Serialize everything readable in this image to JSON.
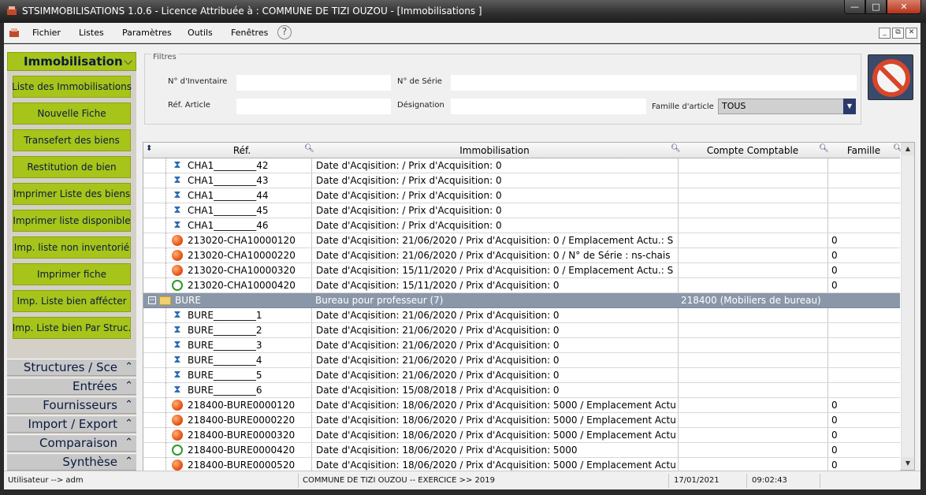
{
  "window": {
    "title": "STSIMMOBILISATIONS 1.0.6   -  Licence Attribuée à :  COMMUNE DE TIZI OUZOU - [Immobilisations ]",
    "minimize": "—",
    "maximize": "□",
    "close": "✕"
  },
  "menu": {
    "items": [
      "Fichier",
      "Listes",
      "Paramètres",
      "Outils",
      "Fenêtres"
    ],
    "help": "?",
    "mdi": [
      "_",
      "⧉",
      "✕"
    ]
  },
  "sidebar": {
    "header": "Immobilisation",
    "buttons": [
      "Liste des Immobilisations",
      "Nouvelle Fiche",
      "Transefert des biens",
      "Restitution de bien",
      "Imprimer Liste des biens",
      "Imprimer liste disponible",
      "Imp. liste non inventorié",
      "Imprimer fiche",
      "Imp. Liste bien affécter",
      "Imp. Liste bien Par Struc."
    ],
    "sections": [
      "Structures / Sce",
      "Entrées",
      "Fournisseurs",
      "Import / Export",
      "Comparaison",
      "Synthèse"
    ]
  },
  "filters": {
    "legend": "Filtres",
    "inventaire_label": "N° d'Inventaire",
    "inventaire_value": "",
    "serie_label": "N° de Série",
    "serie_value": "",
    "ref_article_label": "Réf. Article",
    "ref_article_value": "",
    "designation_label": "Désignation",
    "designation_value": "",
    "famille_label": "Famille d'article",
    "famille_value": "TOUS"
  },
  "grid": {
    "columns": [
      "Réf.",
      "Immobilisation",
      "Compte Comptable",
      "Famille"
    ],
    "rows": [
      {
        "icon": "hourglass",
        "ref": "CHA1_________42",
        "immo": "Date d'Acqisition:   /  Prix d'Acquisition: 0",
        "compte": "",
        "famille": ""
      },
      {
        "icon": "hourglass",
        "ref": "CHA1_________43",
        "immo": "Date d'Acqisition:   /  Prix d'Acquisition: 0",
        "compte": "",
        "famille": ""
      },
      {
        "icon": "hourglass",
        "ref": "CHA1_________44",
        "immo": "Date d'Acqisition:   /  Prix d'Acquisition: 0",
        "compte": "",
        "famille": ""
      },
      {
        "icon": "hourglass",
        "ref": "CHA1_________45",
        "immo": "Date d'Acqisition:   /  Prix d'Acquisition: 0",
        "compte": "",
        "famille": ""
      },
      {
        "icon": "hourglass",
        "ref": "CHA1_________46",
        "immo": "Date d'Acqisition:   /  Prix d'Acquisition: 0",
        "compte": "",
        "famille": ""
      },
      {
        "icon": "orange",
        "ref": "213020-CHA10000120",
        "immo": "Date d'Acqisition: 21/06/2020  /  Prix d'Acquisition: 0 / Emplacement Actu.: S",
        "compte": "",
        "famille": "0"
      },
      {
        "icon": "orange",
        "ref": "213020-CHA10000220",
        "immo": "Date d'Acqisition: 21/06/2020  /  Prix d'Acquisition: 0 / N° de Série :  ns-chais",
        "compte": "",
        "famille": "0"
      },
      {
        "icon": "orange",
        "ref": "213020-CHA10000320",
        "immo": "Date d'Acqisition: 15/11/2020  /  Prix d'Acquisition: 0 / Emplacement Actu.: S",
        "compte": "",
        "famille": "0"
      },
      {
        "icon": "green",
        "ref": "213020-CHA10000420",
        "immo": "Date d'Acqisition: 15/11/2020  /  Prix d'Acquisition: 0",
        "compte": "",
        "famille": "0"
      },
      {
        "group": true,
        "toggle": "−",
        "ref": "BURE",
        "immo": "Bureau pour professeur  (7)",
        "compte": "218400  (Mobiliers de bureau)",
        "famille": ""
      },
      {
        "icon": "hourglass",
        "ref": "BURE_________1",
        "immo": "Date d'Acqisition: 21/06/2020  /  Prix d'Acquisition: 0",
        "compte": "",
        "famille": ""
      },
      {
        "icon": "hourglass",
        "ref": "BURE_________2",
        "immo": "Date d'Acqisition: 21/06/2020  /  Prix d'Acquisition: 0",
        "compte": "",
        "famille": ""
      },
      {
        "icon": "hourglass",
        "ref": "BURE_________3",
        "immo": "Date d'Acqisition: 21/06/2020  /  Prix d'Acquisition: 0",
        "compte": "",
        "famille": ""
      },
      {
        "icon": "hourglass",
        "ref": "BURE_________4",
        "immo": "Date d'Acqisition: 21/06/2020  /  Prix d'Acquisition: 0",
        "compte": "",
        "famille": ""
      },
      {
        "icon": "hourglass",
        "ref": "BURE_________5",
        "immo": "Date d'Acqisition: 21/06/2020  /  Prix d'Acquisition: 0",
        "compte": "",
        "famille": ""
      },
      {
        "icon": "hourglass",
        "ref": "BURE_________6",
        "immo": "Date d'Acqisition: 15/08/2018  /  Prix d'Acquisition: 0",
        "compte": "",
        "famille": ""
      },
      {
        "icon": "orange",
        "ref": "218400-BURE0000120",
        "immo": "Date d'Acqisition: 18/06/2020  /  Prix d'Acquisition: 5000 / Emplacement Actu",
        "compte": "",
        "famille": "0"
      },
      {
        "icon": "orange",
        "ref": "218400-BURE0000220",
        "immo": "Date d'Acqisition: 18/06/2020  /  Prix d'Acquisition: 5000 / Emplacement Actu",
        "compte": "",
        "famille": "0"
      },
      {
        "icon": "orange",
        "ref": "218400-BURE0000320",
        "immo": "Date d'Acqisition: 18/06/2020  /  Prix d'Acquisition: 5000 / Emplacement Actu",
        "compte": "",
        "famille": "0"
      },
      {
        "icon": "green",
        "ref": "218400-BURE0000420",
        "immo": "Date d'Acqisition: 18/06/2020  /  Prix d'Acquisition: 5000",
        "compte": "",
        "famille": "0"
      },
      {
        "icon": "orange",
        "ref": "218400-BURE0000520",
        "immo": "Date d'Acqisition: 18/06/2020  /  Prix d'Acquisition: 5000 / Emplacement Actu",
        "compte": "",
        "famille": "0"
      }
    ]
  },
  "status": {
    "user": "Utilisateur -->  adm",
    "org": "COMMUNE DE TIZI OUZOU    --    EXERCICE >> 2019",
    "date": "17/01/2021",
    "time": "09:02:43"
  },
  "colors": {
    "sidebar_green": "#a7c41a",
    "group_row": "#8a97a8",
    "title_bar": "#2e2e2e"
  }
}
